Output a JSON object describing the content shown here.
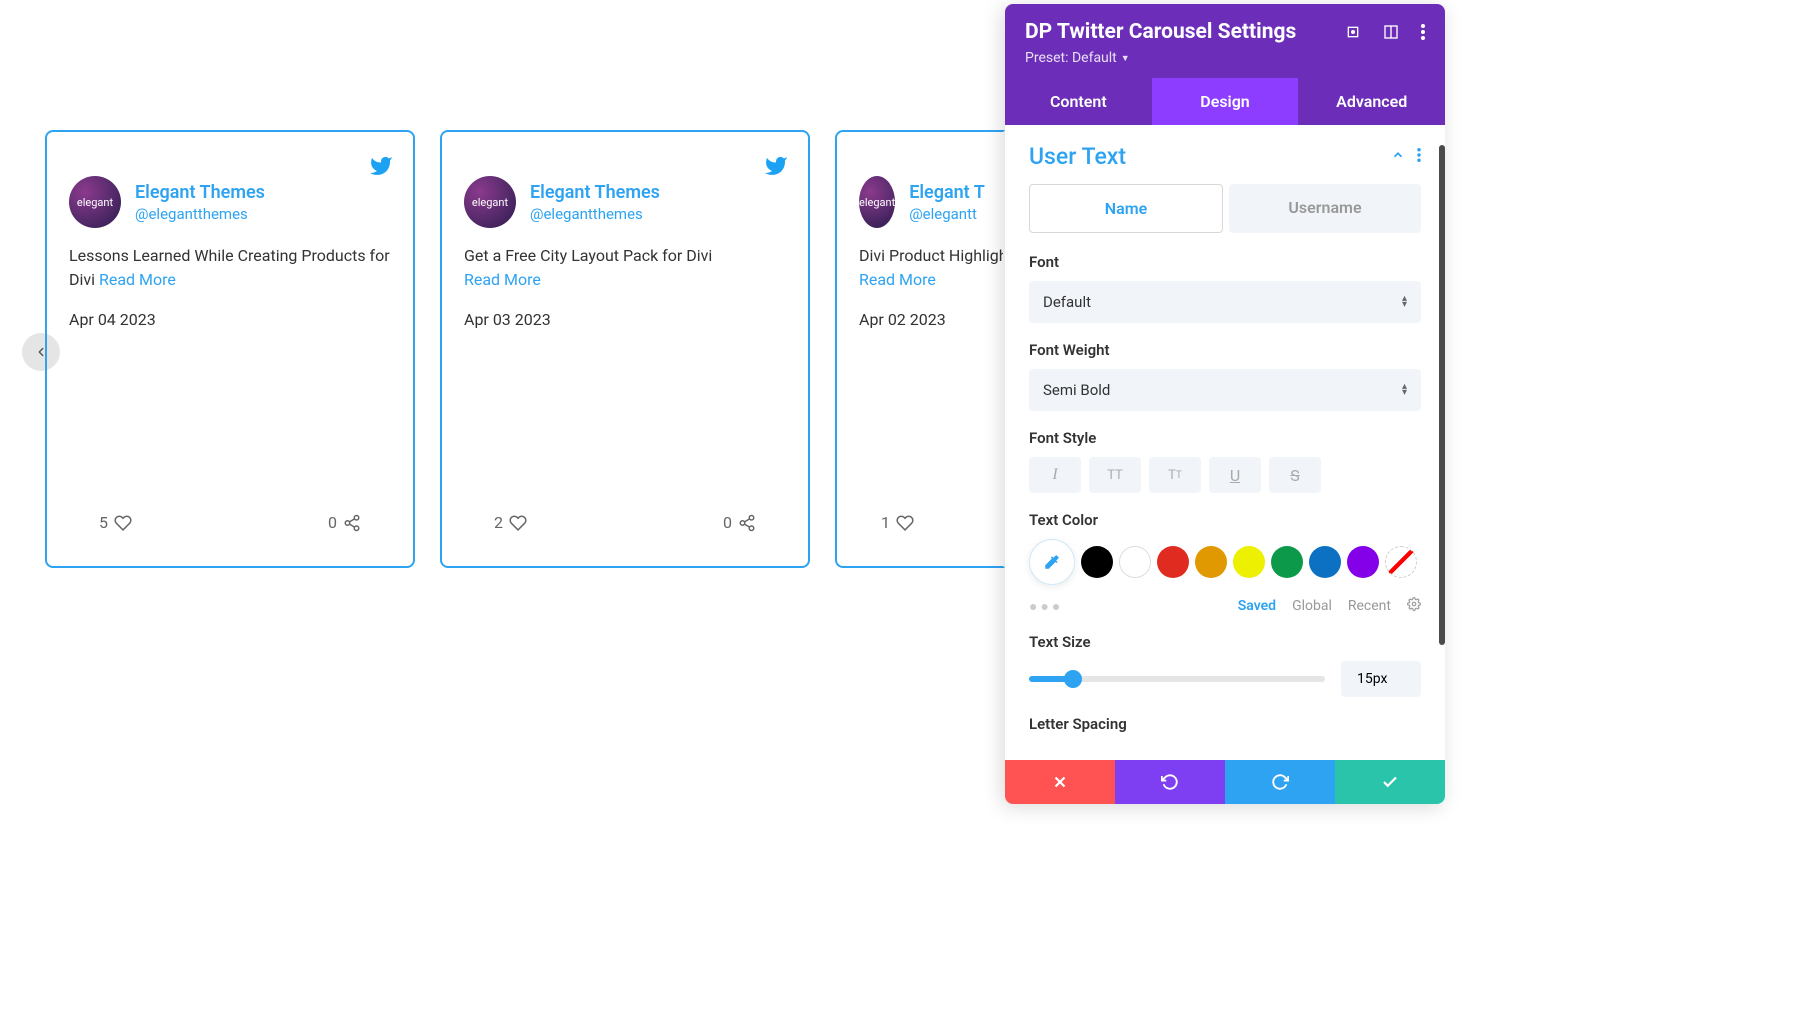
{
  "carousel": {
    "cards": [
      {
        "name": "Elegant Themes",
        "handle": "@elegantthemes",
        "body": "Lessons Learned While Creating Products for Divi ",
        "read_more": "Read More",
        "date": "Apr 04 2023",
        "likes": "5",
        "shares": "0"
      },
      {
        "name": "Elegant Themes",
        "handle": "@elegantthemes",
        "body": "Get a Free City Layout Pack for Divi",
        "read_more": "Read More",
        "date": "Apr 03 2023",
        "likes": "2",
        "shares": "0"
      },
      {
        "name": "Elegant T",
        "handle": "@elegantt",
        "body": "Divi Product Highligh",
        "read_more": "Read More",
        "date": "Apr 02 2023",
        "likes": "1",
        "shares": ""
      }
    ],
    "avatar_text": "elegant"
  },
  "panel": {
    "title": "DP Twitter Carousel Settings",
    "preset": "Preset: Default",
    "tabs": {
      "content": "Content",
      "design": "Design",
      "advanced": "Advanced"
    },
    "section": {
      "title": "User Text",
      "subtabs": {
        "name": "Name",
        "username": "Username"
      },
      "font_label": "Font",
      "font_value": "Default",
      "weight_label": "Font Weight",
      "weight_value": "Semi Bold",
      "style_label": "Font Style",
      "color_label": "Text Color",
      "palette": {
        "saved": "Saved",
        "global": "Global",
        "recent": "Recent"
      },
      "size_label": "Text Size",
      "size_value": "15px",
      "spacing_label": "Letter Spacing"
    },
    "colors": [
      "#000000",
      "#ffffff",
      "#e02b20",
      "#e09900",
      "#edf000",
      "#0c9a4a",
      "#0c71c3",
      "#8300e9"
    ]
  }
}
